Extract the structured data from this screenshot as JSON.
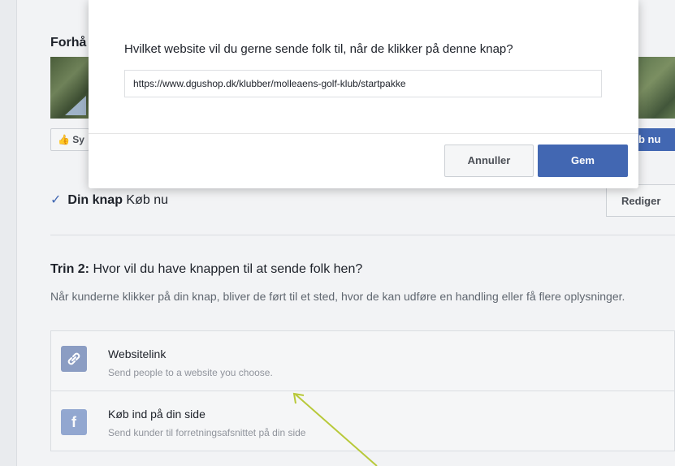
{
  "background": {
    "heading_partial": "Forhå",
    "like_label": "Sy",
    "buy_label": "b nu"
  },
  "din_knap": {
    "label_bold": "Din knap",
    "value": "Køb nu",
    "edit_label": "Rediger"
  },
  "step2": {
    "prefix": "Trin 2:",
    "title": "Hvor vil du have knappen til at sende folk hen?",
    "description": "Når kunderne klikker på din knap, bliver de ført til et sted, hvor de kan udføre en handling eller få flere oplysninger."
  },
  "options": [
    {
      "title": "Websitelink",
      "subtitle": "Send people to a website you choose.",
      "icon": "link-icon"
    },
    {
      "title": "Køb ind på din side",
      "subtitle": "Send kunder til forretningsafsnittet på din side",
      "icon": "facebook-icon"
    }
  ],
  "modal": {
    "question": "Hvilket website vil du gerne sende folk til, når de klikker på denne knap?",
    "url_value": "https://www.dgushop.dk/klubber/molleaens-golf-klub/startpakke",
    "cancel_label": "Annuller",
    "save_label": "Gem"
  },
  "colors": {
    "accent": "#4267b2",
    "arrow": "#b8c93a"
  }
}
